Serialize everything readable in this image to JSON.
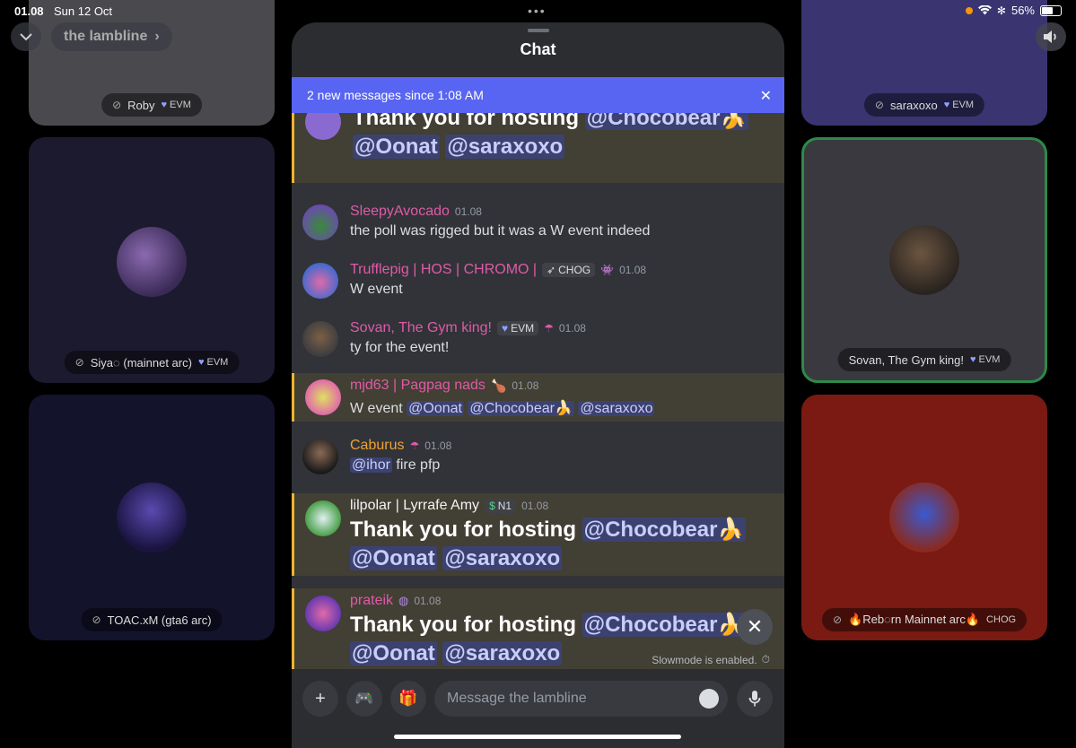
{
  "status_bar": {
    "time": "01.08",
    "date": "Sun 12 Oct",
    "battery": "56%"
  },
  "header": {
    "channel_name": "the lambline",
    "channel_chevron": "›"
  },
  "tiles": [
    {
      "name": "Roby",
      "tag": "EVM"
    },
    {
      "name": "saraxoxo",
      "tag": "EVM"
    },
    {
      "name": "Siya◌ (mainnet arc)",
      "tag": "EVM"
    },
    {
      "name": "Sovan, The Gym king!",
      "tag": "EVM"
    },
    {
      "name": "TOAC.xM (gta6 arc)",
      "tag": ""
    },
    {
      "name": "🔥Reb◌rn Mainnet arc🔥",
      "tag": "CHOG"
    }
  ],
  "chat": {
    "title": "Chat",
    "banner": "2 new messages since 1:08 AM",
    "banner_close": "✕",
    "messages": [
      {
        "big_text": "Thank you for hosting",
        "mentions": [
          "@Chocobear🍌",
          "@Oonat",
          "@saraxoxo"
        ]
      },
      {
        "author": "SleepyAvocado",
        "time": "01.08",
        "text": "the poll was rigged but it was a W event indeed"
      },
      {
        "author": "Trufflepig | HOS | CHROMO |",
        "role": "CHOG",
        "time": "01.08",
        "text": "W event"
      },
      {
        "author": "Sovan, The Gym king!",
        "role": "EVM",
        "time": "01.08",
        "text": "ty for the event!"
      },
      {
        "author": "mjd63 | Pagpag nads",
        "emoji": "🍗",
        "time": "01.08",
        "text": "W event",
        "mentions": [
          "@Oonat",
          "@Chocobear🍌",
          "@saraxoxo"
        ]
      },
      {
        "author": "Caburus",
        "time": "01.08",
        "mention": "@ihor",
        "text": "fire pfp"
      },
      {
        "author": "lilpolar | Lyrrafe Amy",
        "role": "N1",
        "time": "01.08",
        "big_text": "Thank you for hosting",
        "mentions": [
          "@Chocobear🍌",
          "@Oonat",
          "@saraxoxo"
        ]
      },
      {
        "author": "prateik",
        "time": "01.08",
        "big_text": "Thank you for hosting",
        "mentions": [
          "@Chocobear🍌",
          "@Oonat",
          "@saraxoxo"
        ]
      }
    ],
    "slowmode": "Slowmode is enabled.",
    "input_placeholder": "Message the lambline"
  },
  "colors": {
    "accent": "#5865f2",
    "mention_bar": "#f0b232",
    "name_pink": "#e05aa8",
    "name_orange": "#f0a232"
  }
}
